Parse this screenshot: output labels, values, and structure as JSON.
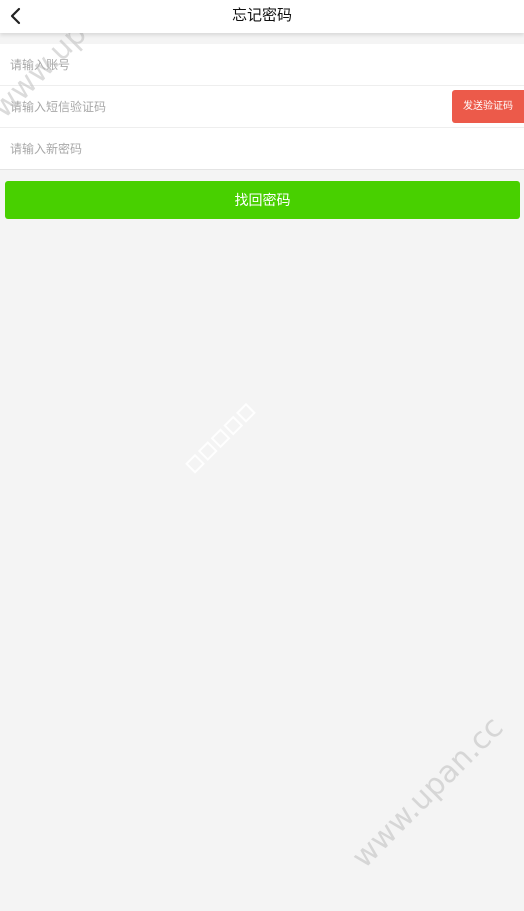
{
  "header": {
    "title": "忘记密码"
  },
  "form": {
    "account_placeholder": "请输入账号",
    "sms_code_placeholder": "请输入短信验证码",
    "send_code_label": "发送验证码",
    "new_password_placeholder": "请输入新密码",
    "submit_label": "找回密码"
  },
  "watermark": {
    "text": "www.upan.cc"
  },
  "colors": {
    "submit_green": "#48d000",
    "send_code_red": "#ec5a4a",
    "page_background": "#f4f4f4"
  }
}
